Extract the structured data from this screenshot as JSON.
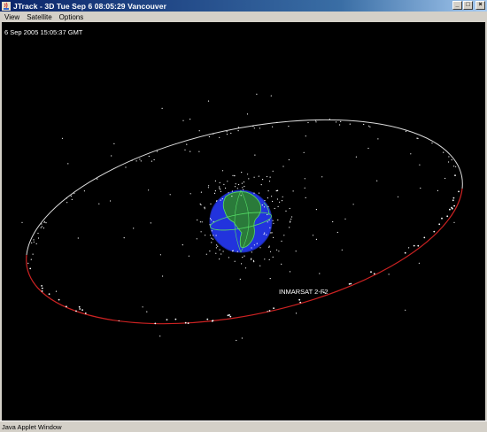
{
  "window": {
    "title": "JTrack - 3D   Tue Sep 6 08:05:29 Vancouver",
    "minimize_glyph": "_",
    "maximize_glyph": "□",
    "close_glyph": "×"
  },
  "menu": {
    "items": [
      "View",
      "Satellite",
      "Options"
    ]
  },
  "viewport": {
    "timestamp": "6 Sep 2005 15:05:37 GMT",
    "selected_satellite": "INMARSAT 2-F2"
  },
  "colors": {
    "background": "#000000",
    "ocean": "#2233dd",
    "land": "#22aa44",
    "orbit_front": "#cc2222",
    "orbit_back": "#dddddd",
    "satellite": "#ffffff"
  },
  "statusbar": {
    "text": "Java Applet Window"
  }
}
